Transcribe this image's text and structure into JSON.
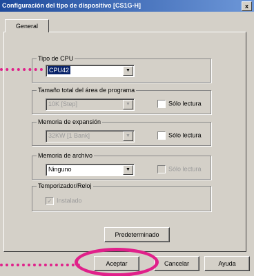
{
  "window": {
    "title": "Configuración del tipo de dispositivo [CS1G-H]",
    "close_label": "x"
  },
  "tabs": [
    {
      "label": "General",
      "selected": true
    }
  ],
  "groups": {
    "cpu_type": {
      "label": "Tipo de CPU",
      "value": "CPU42"
    },
    "program_area": {
      "label": "Tamaño total del área de programa",
      "value": "10K [Step]",
      "checkbox": "Sólo lectura"
    },
    "expansion_memory": {
      "label": "Memoria de expansión",
      "value": "32KW [1 Bank]",
      "checkbox": "Sólo lectura"
    },
    "file_memory": {
      "label": "Memoria de archivo",
      "value": "Ninguno",
      "checkbox": "Sólo lectura"
    },
    "timer_clock": {
      "label": "Temporizador/Reloj",
      "checkbox": "Instalado"
    }
  },
  "buttons": {
    "default": "Predeterminado",
    "accept": "Aceptar",
    "cancel": "Cancelar",
    "help": "Ayuda"
  },
  "colors": {
    "highlight": "#e0208a",
    "titlebar": "#1e4a9c",
    "selection": "#0a246a"
  },
  "icons": {
    "dropdown": "chevron-down-icon",
    "close": "close-icon"
  }
}
